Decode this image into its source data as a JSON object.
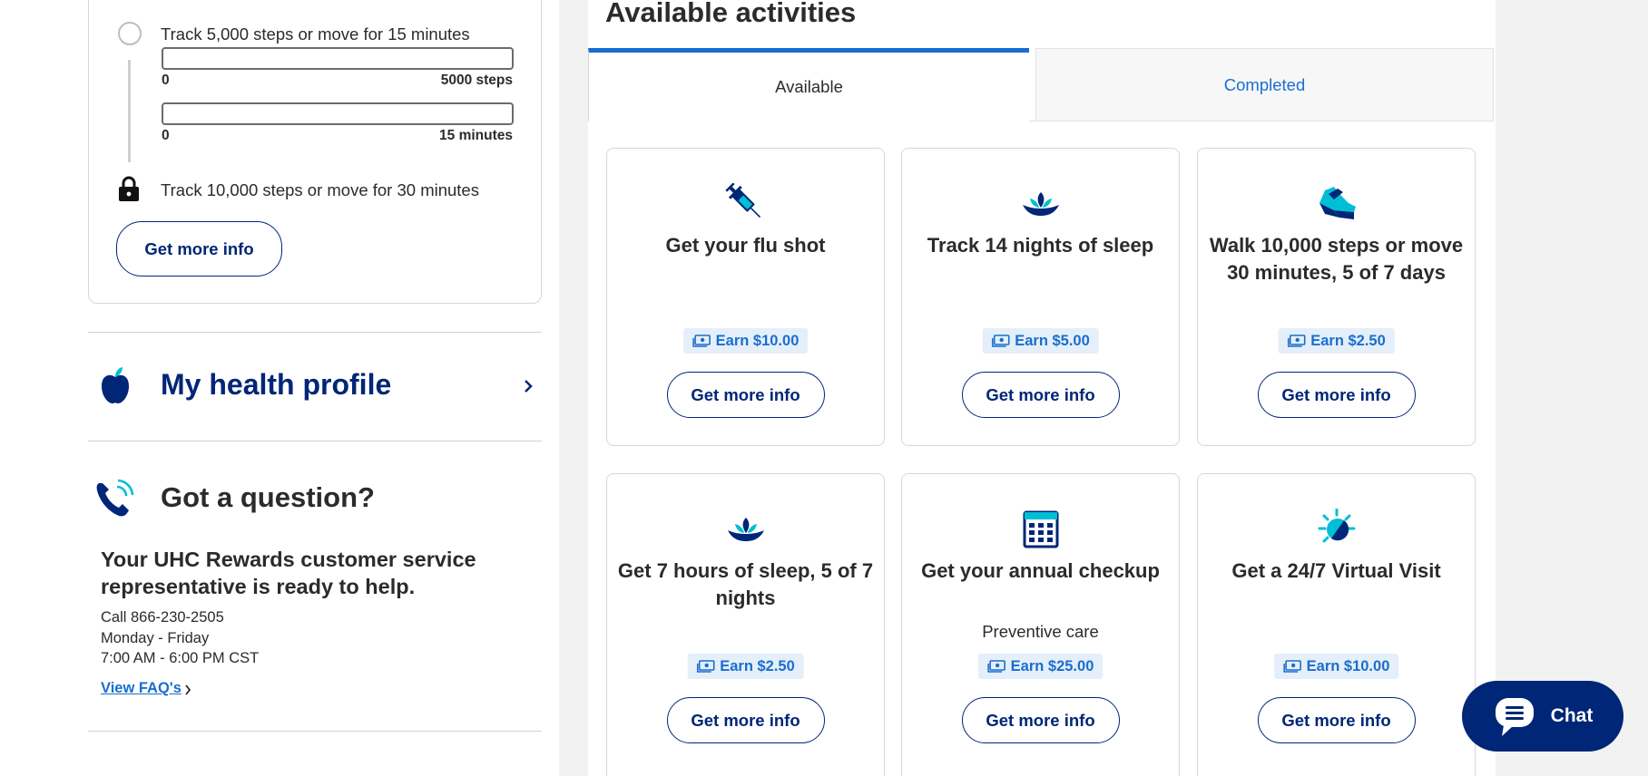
{
  "tracker": {
    "step1_label": "Track 5,000 steps or move for 15 minutes",
    "bar1": {
      "min": "0",
      "max": "5000 steps",
      "progress": 0
    },
    "bar2": {
      "min": "0",
      "max": "15 minutes",
      "progress": 0
    },
    "step2_label": "Track 10,000 steps or move for 30 minutes",
    "button_label": "Get more info"
  },
  "health_profile": {
    "title": "My health profile"
  },
  "question": {
    "title": "Got a question?",
    "subtitle": "Your UHC Rewards customer service representative is ready to help.",
    "phone": "Call 866-230-2505",
    "days": "Monday - Friday",
    "hours": "7:00 AM - 6:00 PM CST",
    "faq_link": "View FAQ's"
  },
  "activities": {
    "title": "Available activities",
    "tabs": [
      {
        "label": "Available",
        "selected": true
      },
      {
        "label": "Completed",
        "selected": false
      }
    ],
    "cards": [
      {
        "icon": "syringe-icon",
        "title": "Get your flu shot",
        "subtitle": "",
        "earn": "Earn $10.00",
        "button": "Get more info"
      },
      {
        "icon": "lotus-icon",
        "title": "Track 14 nights of sleep",
        "subtitle": "",
        "earn": "Earn $5.00",
        "button": "Get more info"
      },
      {
        "icon": "sneaker-icon",
        "title": "Walk 10,000 steps or move 30 minutes, 5 of 7 days",
        "subtitle": "",
        "earn": "Earn $2.50",
        "button": "Get more info"
      },
      {
        "icon": "lotus-icon",
        "title": "Get 7 hours of sleep, 5 of 7 nights",
        "subtitle": "",
        "earn": "Earn $2.50",
        "button": "Get more info"
      },
      {
        "icon": "calendar-icon",
        "title": "Get your annual checkup",
        "subtitle": "Preventive care",
        "earn": "Earn $25.00",
        "button": "Get more info"
      },
      {
        "icon": "sun-moon-icon",
        "title": "Get a 24/7 Virtual Visit",
        "subtitle": "",
        "earn": "Earn $10.00",
        "button": "Get more info"
      }
    ]
  },
  "chat": {
    "label": "Chat"
  },
  "colors": {
    "brand_navy": "#002677",
    "accent_blue": "#196ecf",
    "teal": "#00bed5"
  }
}
